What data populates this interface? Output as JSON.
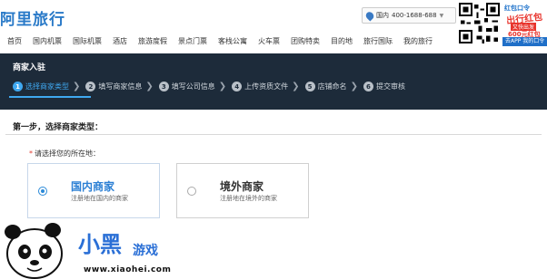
{
  "header": {
    "brand": "阿里旅行",
    "hotline_region": "国内",
    "hotline_number": "400-1688-688",
    "promo": {
      "line1": "红包口令",
      "line2": "出行红包",
      "line3": "又快出发",
      "line4": "600元红包",
      "line5": "去APP 我的口令"
    }
  },
  "nav": {
    "items": [
      "首页",
      "国内机票",
      "国际机票",
      "酒店",
      "旅游度假",
      "景点门票",
      "客栈公寓",
      "火车票",
      "团购特卖",
      "目的地",
      "旅行国际",
      "我的旅行"
    ]
  },
  "panel": {
    "title": "商家入驻",
    "steps": [
      {
        "num": "1",
        "label": "选择商家类型"
      },
      {
        "num": "2",
        "label": "填写商家信息"
      },
      {
        "num": "3",
        "label": "填写公司信息"
      },
      {
        "num": "4",
        "label": "上传资质文件"
      },
      {
        "num": "5",
        "label": "店铺命名"
      },
      {
        "num": "6",
        "label": "提交审核"
      }
    ],
    "active_step": 1
  },
  "form": {
    "heading": "第一步，选择商家类型：",
    "location_label": "请选择您的所在地：",
    "required_mark": "*",
    "options": [
      {
        "title": "国内商家",
        "subtitle": "注册地在国内的商家",
        "selected": true
      },
      {
        "title": "境外商家",
        "subtitle": "注册地在境外的商家",
        "selected": false
      }
    ]
  },
  "watermark": {
    "brand": "小黑",
    "brand_suffix": "游戏",
    "url": "www.xiaohei.com"
  },
  "colors": {
    "brand_blue": "#2a7ac8",
    "panel_bg": "#1d2b3a",
    "active_step": "#3fa8f0",
    "required": "#e03c31"
  }
}
